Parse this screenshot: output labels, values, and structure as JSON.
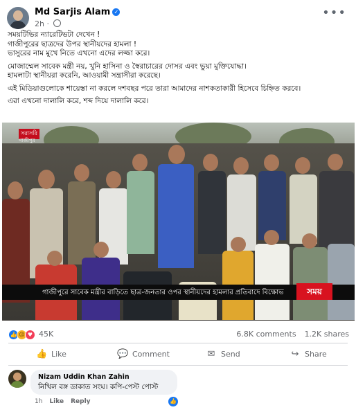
{
  "post": {
    "author": "Md Sarjis Alam",
    "time": "2h",
    "lines": [
      "সময়টিভির ন্যারেটিভটা দেখেন !",
      "গাজীপুরের ছাত্রদের উপর স্থানীয়দের হামলা !",
      "ভাসুরের নাম মুখে নিতে এখনো এদের লজ্জা করে।",
      "মোজাম্মেল সাবেক মন্ত্রী নয়, খুনি হাসিনা ও স্বৈরাচারের দোসর এবং ভুয়া মুক্তিযোদ্ধা।",
      "হামলাটা স্থানীয়রা করেনি, আওয়ামী সন্ত্রাসীরা করেছে।",
      "এই মিডিয়াগুলোকে শায়েস্তা না করলে দশবছর পরে তারা আমাদের নাশকতাকারী হিসেবে চিহ্নিত করবে।",
      "এরা এখনো দালালি করে, শব্দ দিয়ে দালালি করে।"
    ]
  },
  "media": {
    "live_label": "সরাসরি",
    "location": "গাজীপুর",
    "caption": "গাজীপুরে সাবেক মন্ত্রীর বাড়িতে ছাত্র-জনতার ওপর স্থানীয়দের হামলার প্রতিবাদে বিক্ষোভ",
    "channel_logo": "সময়"
  },
  "stats": {
    "reactions": "45K",
    "comments": "6.8K comments",
    "shares": "1.2K shares"
  },
  "actions": {
    "like": "Like",
    "comment": "Comment",
    "send": "Send",
    "share": "Share"
  },
  "comment": {
    "author": "Nizam Uddin Khan Zahin",
    "text": "নিখিল বঙ্গ ডাকাত সংঘ। কপি-পেস্ট পোস্ট",
    "time": "1h",
    "like": "Like",
    "reply": "Reply"
  },
  "colors": {
    "accent": "#1877f2",
    "secondary_text": "#65676b",
    "channel_red": "#d8121f"
  }
}
